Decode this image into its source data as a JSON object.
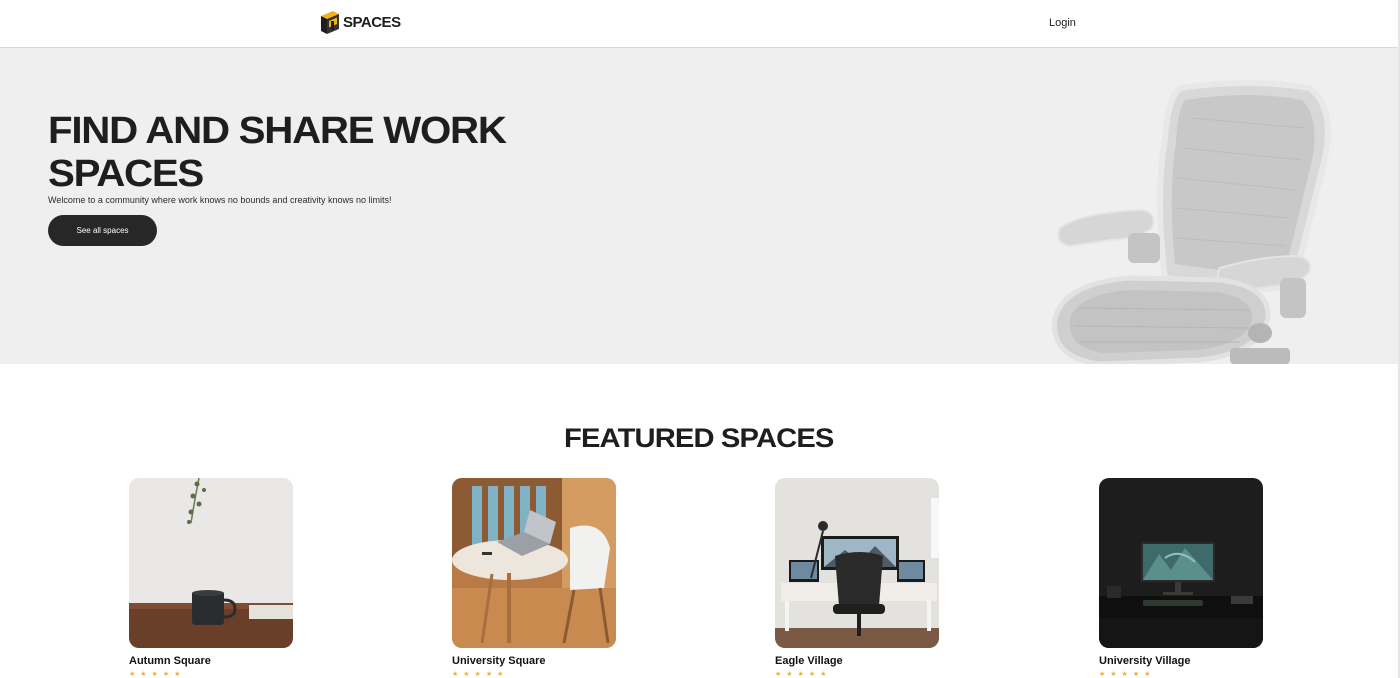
{
  "nav": {
    "logo_text": "SPACES",
    "login_label": "Login"
  },
  "hero": {
    "title": "FIND AND SHARE WORK SPACES",
    "subtitle": "Welcome to a community where work knows no bounds and creativity knows no limits!",
    "cta_label": "See all spaces"
  },
  "featured": {
    "title": "FEATURED SPACES",
    "spaces": [
      {
        "name": "Autumn Square",
        "stars": "★★★★★"
      },
      {
        "name": "University Square",
        "stars": "★★★★★"
      },
      {
        "name": "Eagle Village",
        "stars": "★★★★★"
      },
      {
        "name": "University Village",
        "stars": "★★★★★"
      }
    ]
  },
  "colors": {
    "brand_accent": "#f2b21b",
    "dark": "#1e1e1e",
    "hero_bg": "#efefef"
  }
}
